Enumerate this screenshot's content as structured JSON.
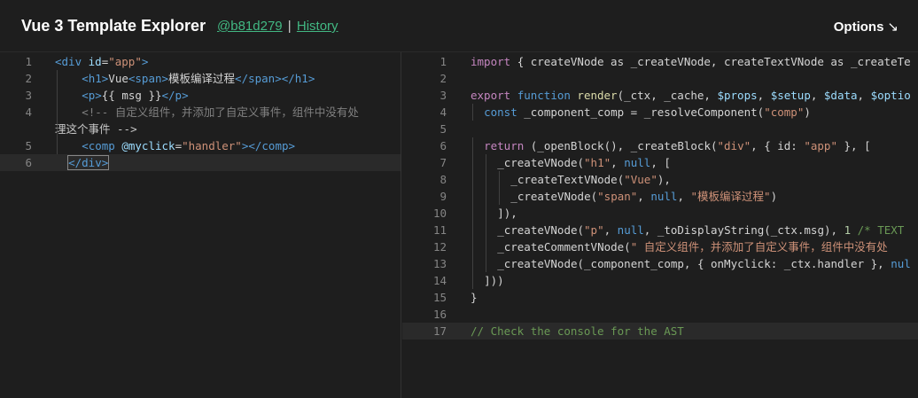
{
  "header": {
    "title": "Vue 3 Template Explorer",
    "commit": "@b81d279",
    "separator": "|",
    "history": "History",
    "options": "Options",
    "options_icon": "↘"
  },
  "template_pane": {
    "line_numbers": [
      "1",
      "2",
      "3",
      "4",
      "5",
      "6"
    ],
    "lines": [
      {
        "parts": [
          [
            "tag",
            "<div "
          ],
          [
            "attr",
            "id"
          ],
          [
            "plain",
            "="
          ],
          [
            "str",
            "\"app\""
          ],
          [
            "tag",
            ">"
          ]
        ]
      },
      {
        "parts": [
          [
            "tag",
            "<h1>"
          ],
          [
            "plain",
            "Vue"
          ],
          [
            "tag",
            "<span>"
          ],
          [
            "plain",
            "模板编译过程"
          ],
          [
            "tag",
            "</span></h1>"
          ]
        ]
      },
      {
        "parts": [
          [
            "tag",
            "<p>"
          ],
          [
            "plain",
            "{{ msg }}"
          ],
          [
            "tag",
            "</p>"
          ]
        ]
      },
      {
        "parts": [
          [
            "gray",
            "<!-- 自定义组件，并添加了自定义事件，组件中没有处"
          ]
        ],
        "continuation": "理这个事件 -->"
      },
      {
        "parts": [
          [
            "tag",
            "<comp "
          ],
          [
            "attr",
            "@myclick"
          ],
          [
            "plain",
            "="
          ],
          [
            "str",
            "\"handler\""
          ],
          [
            "tag",
            "></comp>"
          ]
        ]
      },
      {
        "parts": [
          [
            "tag",
            "</div>"
          ]
        ]
      }
    ]
  },
  "output_pane": {
    "line_numbers": [
      "1",
      "2",
      "3",
      "4",
      "5",
      "6",
      "7",
      "8",
      "9",
      "10",
      "11",
      "12",
      "13",
      "14",
      "15",
      "16",
      "17"
    ],
    "lines": [
      {
        "parts": [
          [
            "kw",
            "import "
          ],
          [
            "plain",
            "{ createVNode as _createVNode, createTextVNode as _createTe"
          ]
        ]
      },
      {
        "parts": []
      },
      {
        "parts": [
          [
            "kw",
            "export "
          ],
          [
            "kw2",
            "function "
          ],
          [
            "fn",
            "render"
          ],
          [
            "plain",
            "(_ctx, _cache, "
          ],
          [
            "var",
            "$props"
          ],
          [
            "plain",
            ", "
          ],
          [
            "var",
            "$setup"
          ],
          [
            "plain",
            ", "
          ],
          [
            "var",
            "$data"
          ],
          [
            "plain",
            ", "
          ],
          [
            "var",
            "$optio"
          ]
        ]
      },
      {
        "parts": [
          [
            "kw2",
            "const "
          ],
          [
            "plain",
            "_component_comp = _resolveComponent("
          ],
          [
            "str",
            "\"comp\""
          ],
          [
            "plain",
            ")"
          ]
        ]
      },
      {
        "parts": []
      },
      {
        "parts": [
          [
            "kw",
            "return "
          ],
          [
            "plain",
            "(_openBlock(), _createBlock("
          ],
          [
            "str",
            "\"div\""
          ],
          [
            "plain",
            ", { id: "
          ],
          [
            "str",
            "\"app\""
          ],
          [
            "plain",
            " }, ["
          ]
        ]
      },
      {
        "parts": [
          [
            "plain",
            "_createVNode("
          ],
          [
            "str",
            "\"h1\""
          ],
          [
            "plain",
            ", "
          ],
          [
            "kw2",
            "null"
          ],
          [
            "plain",
            ", ["
          ]
        ]
      },
      {
        "parts": [
          [
            "plain",
            "_createTextVNode("
          ],
          [
            "str",
            "\"Vue\""
          ],
          [
            "plain",
            "),"
          ]
        ]
      },
      {
        "parts": [
          [
            "plain",
            "_createVNode("
          ],
          [
            "str",
            "\"span\""
          ],
          [
            "plain",
            ", "
          ],
          [
            "kw2",
            "null"
          ],
          [
            "plain",
            ", "
          ],
          [
            "str",
            "\"模板编译过程\""
          ],
          [
            "plain",
            ")"
          ]
        ]
      },
      {
        "parts": [
          [
            "plain",
            "]),"
          ]
        ]
      },
      {
        "parts": [
          [
            "plain",
            "_createVNode("
          ],
          [
            "str",
            "\"p\""
          ],
          [
            "plain",
            ", "
          ],
          [
            "kw2",
            "null"
          ],
          [
            "plain",
            ", _toDisplayString(_ctx.msg), "
          ],
          [
            "num",
            "1"
          ],
          [
            "cmt",
            " /* TEXT "
          ]
        ]
      },
      {
        "parts": [
          [
            "plain",
            "_createCommentVNode("
          ],
          [
            "str",
            "\" 自定义组件，并添加了自定义事件，组件中没有处"
          ]
        ]
      },
      {
        "parts": [
          [
            "plain",
            "_createVNode(_component_comp, { onMyclick: _ctx.handler }, "
          ],
          [
            "kw2",
            "nul"
          ]
        ]
      },
      {
        "parts": [
          [
            "plain",
            "]))"
          ]
        ]
      },
      {
        "parts": [
          [
            "plain",
            "}"
          ]
        ]
      },
      {
        "parts": []
      },
      {
        "parts": [
          [
            "cmt",
            "// Check the console for the AST"
          ]
        ]
      }
    ]
  }
}
